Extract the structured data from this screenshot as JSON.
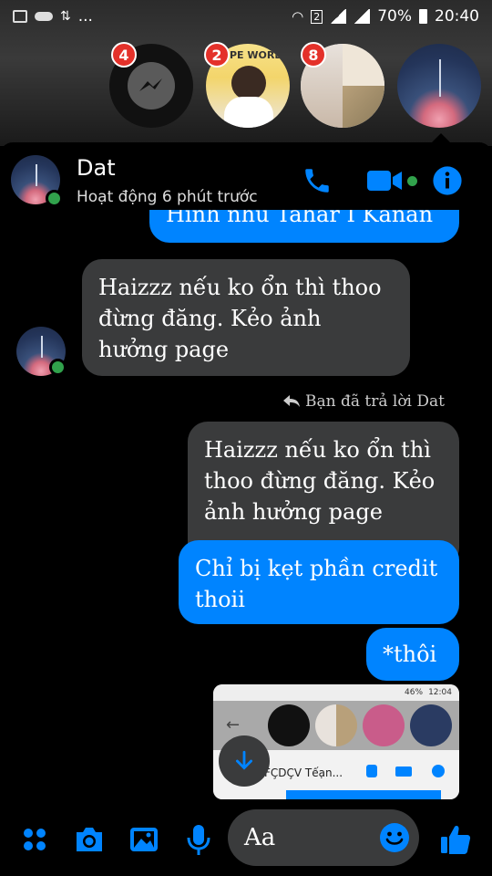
{
  "status_bar": {
    "battery": "70%",
    "time": "20:40",
    "sim": "2",
    "notif_more": "..."
  },
  "chat_heads": [
    {
      "badge": "4",
      "icon": "messenger-icon"
    },
    {
      "badge": "2",
      "label": "PE WORL"
    },
    {
      "badge": "8"
    },
    {}
  ],
  "header": {
    "name": "Dat",
    "status": "Hoạt động 6 phút trước"
  },
  "messages": {
    "partial": "Hình nhu Tahar I Kanan",
    "incoming_1": "Haizzz nếu ko ổn thì thoo đừng đăng. Kẻo ảnh hưởng page",
    "reply_note": "Bạn đã trả lời Dat",
    "quoted": "Haizzz nếu ko ổn thì thoo đừng đăng. Kẻo ảnh hưởng page",
    "outgoing_1": "Chỉ bị kẹt phần credit thoii",
    "outgoing_2": "*thôi"
  },
  "screenshot_thumb": {
    "status_text": "46%",
    "time": "12:04",
    "title": "FÇDÇV Tếạn..."
  },
  "composer": {
    "placeholder": "Aa"
  },
  "colors": {
    "accent": "#0084ff",
    "bubble_gray": "#3a3b3c",
    "badge_red": "#e4312a",
    "online": "#31a24c"
  }
}
